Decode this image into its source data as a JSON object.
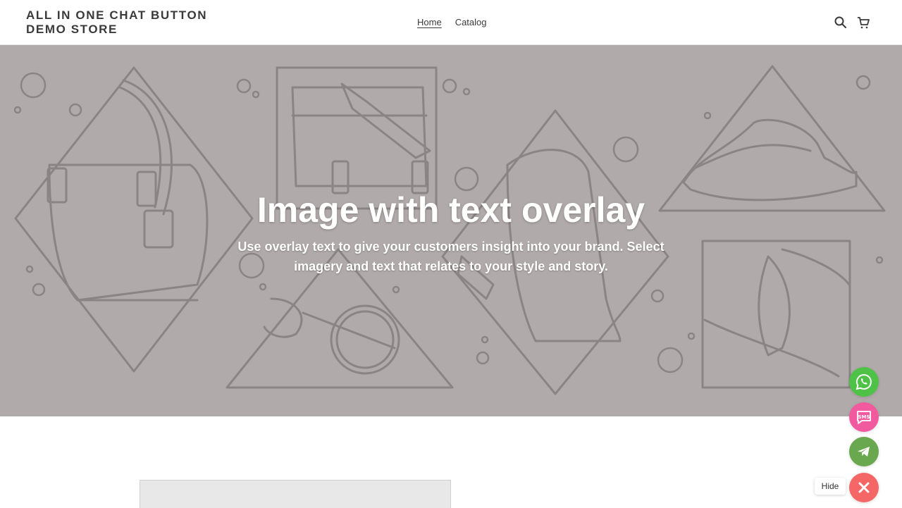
{
  "header": {
    "store_name": "ALL IN ONE CHAT BUTTON DEMO STORE",
    "nav": [
      {
        "label": "Home",
        "active": true
      },
      {
        "label": "Catalog",
        "active": false
      }
    ],
    "icons": [
      "search-icon",
      "cart-icon"
    ]
  },
  "hero": {
    "title": "Image with text overlay",
    "subtitle": "Use overlay text to give your customers insight into your brand. Select imagery and text that relates to your style and story.",
    "background_color": "#b1aaaa",
    "line_color": "#8a8484"
  },
  "chat_widget": {
    "buttons": [
      {
        "name": "whatsapp",
        "icon": "whatsapp-icon",
        "color": "#4dc247"
      },
      {
        "name": "sms",
        "icon": "sms-icon",
        "label": "SMS",
        "color": "#f25aa0"
      },
      {
        "name": "telegram",
        "icon": "telegram-icon",
        "color": "#6aa84f"
      },
      {
        "name": "close",
        "icon": "close-icon",
        "color": "#f56767"
      }
    ],
    "hide_label": "Hide"
  }
}
